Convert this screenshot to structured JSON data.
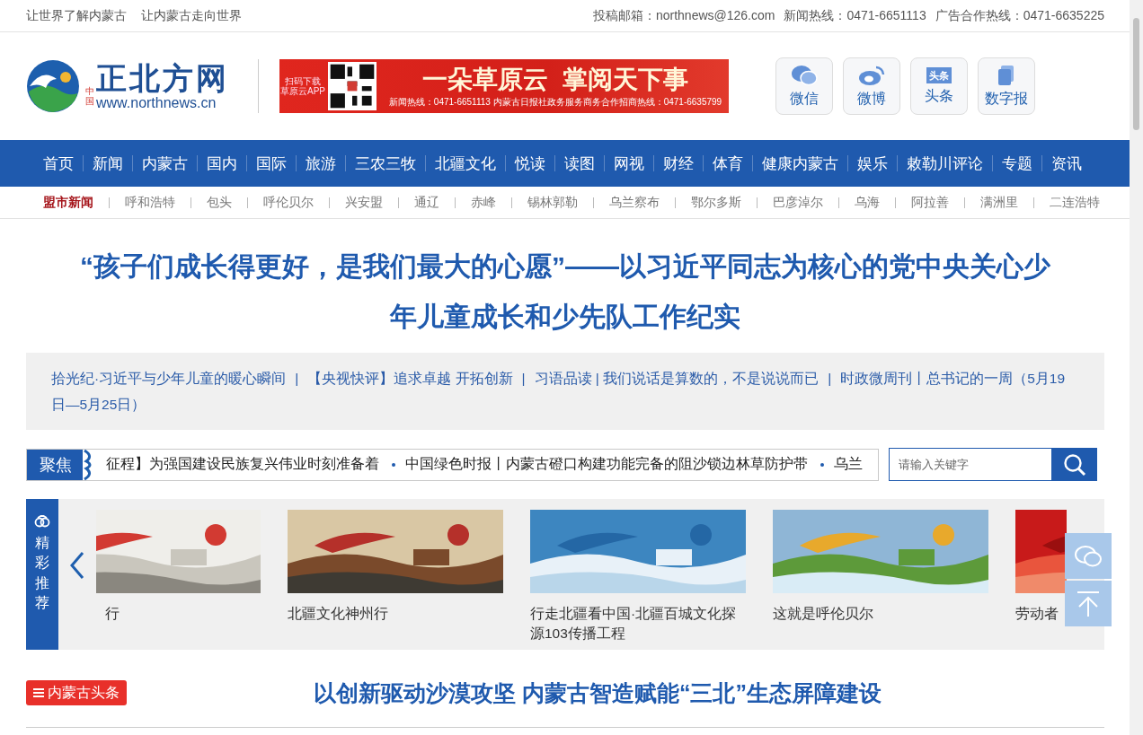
{
  "top_bar": {
    "slogans": [
      "让世界了解内蒙古",
      "让内蒙古走向世界"
    ],
    "contacts": [
      "投稿邮箱：northnews@126.com",
      "新闻热线：0471-6651113",
      "广告合作热线：0471-6635225"
    ]
  },
  "header": {
    "logo": {
      "badge": "中国",
      "name": "正北方网",
      "url": "www.northnews.cn"
    },
    "banner": {
      "qr_caption": [
        "扫码下载",
        "草原云APP"
      ],
      "slogan": "一朵草原云  掌阅天下事",
      "hotlines": "新闻热线：0471-6651113  内蒙古日报社政务服务商务合作招商热线：0471-6635799"
    },
    "social": [
      {
        "kind": "wechat",
        "label": "微信"
      },
      {
        "kind": "weibo",
        "label": "微博"
      },
      {
        "kind": "toutiao",
        "label": "头条",
        "icon_text": "头条"
      },
      {
        "kind": "paper",
        "label": "数字报"
      }
    ]
  },
  "nav": [
    "首页",
    "新闻",
    "内蒙古",
    "国内",
    "国际",
    "旅游",
    "三农三牧",
    "北疆文化",
    "悦读",
    "读图",
    "网视",
    "财经",
    "体育",
    "健康内蒙古",
    "娱乐",
    "敕勒川评论",
    "专题",
    "资讯"
  ],
  "sub_nav": [
    {
      "label": "盟市新闻",
      "selected": true
    },
    {
      "label": "呼和浩特",
      "selected": false
    },
    {
      "label": "包头",
      "selected": false
    },
    {
      "label": "呼伦贝尔",
      "selected": false
    },
    {
      "label": "兴安盟",
      "selected": false
    },
    {
      "label": "通辽",
      "selected": false
    },
    {
      "label": "赤峰",
      "selected": false
    },
    {
      "label": "锡林郭勒",
      "selected": false
    },
    {
      "label": "乌兰察布",
      "selected": false
    },
    {
      "label": "鄂尔多斯",
      "selected": false
    },
    {
      "label": "巴彦淖尔",
      "selected": false
    },
    {
      "label": "乌海",
      "selected": false
    },
    {
      "label": "阿拉善",
      "selected": false
    },
    {
      "label": "满洲里",
      "selected": false
    },
    {
      "label": "二连浩特",
      "selected": false
    }
  ],
  "headline": "“孩子们成长得更好，是我们最大的心愿”——以习近平同志为核心的党中央关心少年儿童成长和少先队工作纪实",
  "related": {
    "separator": "|",
    "links": [
      "拾光纪·习近平与少年儿童的暖心瞬间",
      "【央视快评】追求卓越 开拓创新",
      "习语品读 | 我们说话是算数的，不是说说而已",
      "时政微周刊丨总书记的一周（5月19日—5月25日）"
    ]
  },
  "focus": {
    "label": "聚焦",
    "items": [
      "征程】为强国建设民族复兴伟业时刻准备着",
      "中国绿色时报丨内蒙古磴口构建功能完备的阻沙锁边林草防护带",
      "乌兰"
    ]
  },
  "search": {
    "placeholder": "请输入关键字"
  },
  "recommend": {
    "label": "精彩推荐",
    "items": [
      {
        "caption": "行",
        "kind": "picture"
      },
      {
        "caption": "北疆文化神州行",
        "kind": "picture"
      },
      {
        "caption": "行走北疆看中国·北疆百城文化探源103传播工程",
        "kind": "picture"
      },
      {
        "caption": "这就是呼伦贝尔",
        "kind": "picture"
      },
      {
        "caption": "劳动者",
        "kind": "picture"
      }
    ]
  },
  "top_story": {
    "tag": "内蒙古头条",
    "title": "以创新驱动沙漠攻坚 内蒙古智造赋能“三北”生态屏障建设"
  }
}
